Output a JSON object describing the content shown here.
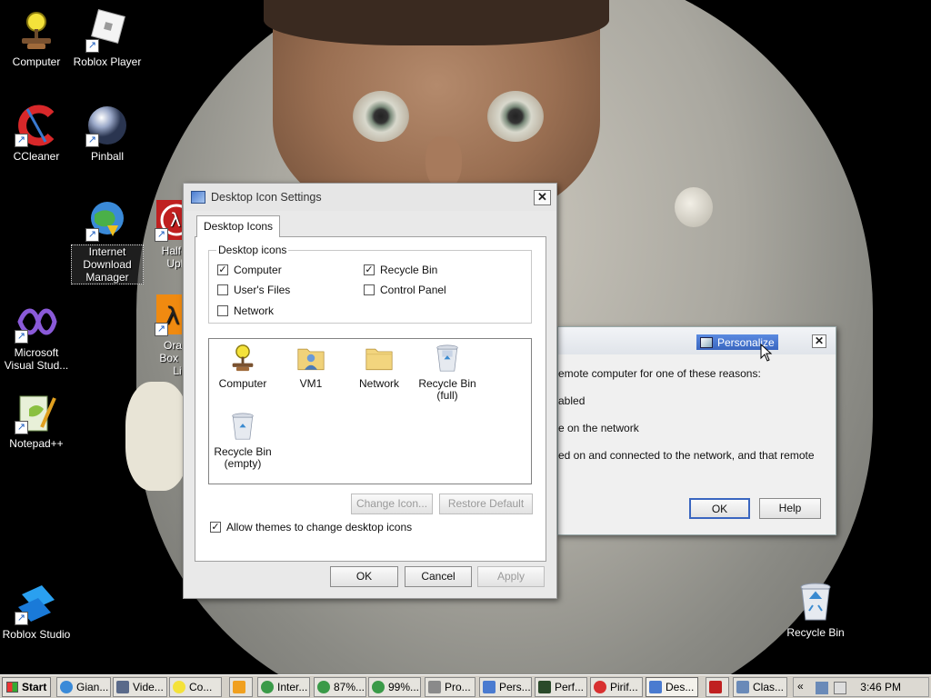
{
  "desktop": {
    "icons": [
      {
        "label": "Computer"
      },
      {
        "label": "Roblox Player"
      },
      {
        "label": "CCleaner"
      },
      {
        "label": "Pinball"
      },
      {
        "label": "Internet Download Manager"
      },
      {
        "label": "Half-Life Uplink"
      },
      {
        "label": "Microsoft Visual Stud..."
      },
      {
        "label": "Orange Box Half-Life"
      },
      {
        "label": "Notepad++"
      },
      {
        "label": "Roblox Studio"
      },
      {
        "label": "Recycle Bin"
      }
    ]
  },
  "dialog": {
    "title": "Desktop Icon Settings",
    "close_glyph": "✕",
    "tab_label": "Desktop Icons",
    "group_label": "Desktop icons",
    "checkboxes": [
      {
        "label": "Computer",
        "checked": true
      },
      {
        "label": "Recycle Bin",
        "checked": true
      },
      {
        "label": "User's Files",
        "checked": false
      },
      {
        "label": "Control Panel",
        "checked": false
      },
      {
        "label": "Network",
        "checked": false
      }
    ],
    "list_items": [
      {
        "label": "Computer"
      },
      {
        "label": "VM1"
      },
      {
        "label": "Network"
      },
      {
        "label": "Recycle Bin (full)"
      },
      {
        "label": "Recycle Bin (empty)"
      }
    ],
    "change_icon_label": "Change Icon...",
    "restore_default_label": "Restore Default",
    "allow_themes_label": "Allow themes to change desktop icons",
    "allow_themes_checked": true,
    "ok_label": "OK",
    "cancel_label": "Cancel",
    "apply_label": "Apply",
    "check_glyph": "✓"
  },
  "error_window": {
    "title": "Personalize",
    "close_glyph": "✕",
    "lines": [
      "emote computer for one of these reasons:",
      "abled",
      "e on the network",
      "ed on and connected to the network, and that remote"
    ],
    "ok_label": "OK",
    "help_label": "Help"
  },
  "taskbar": {
    "start_label": "Start",
    "buttons": [
      {
        "label": "Gian..."
      },
      {
        "label": "Vide..."
      },
      {
        "label": "Co..."
      },
      {
        "label": ""
      },
      {
        "label": "Inter..."
      },
      {
        "label": "87%..."
      },
      {
        "label": "99%..."
      },
      {
        "label": "Pro..."
      },
      {
        "label": "Pers..."
      },
      {
        "label": "Perf..."
      },
      {
        "label": "Pirif..."
      },
      {
        "label": "Des..."
      },
      {
        "label": ""
      },
      {
        "label": "Clas..."
      }
    ],
    "chevron_glyph": "«",
    "clock": "3:46 PM"
  },
  "colors": {
    "accent": "#3a66c0",
    "window_bg": "#f0f0f0",
    "taskbar_bg": "#d4d0c8"
  }
}
